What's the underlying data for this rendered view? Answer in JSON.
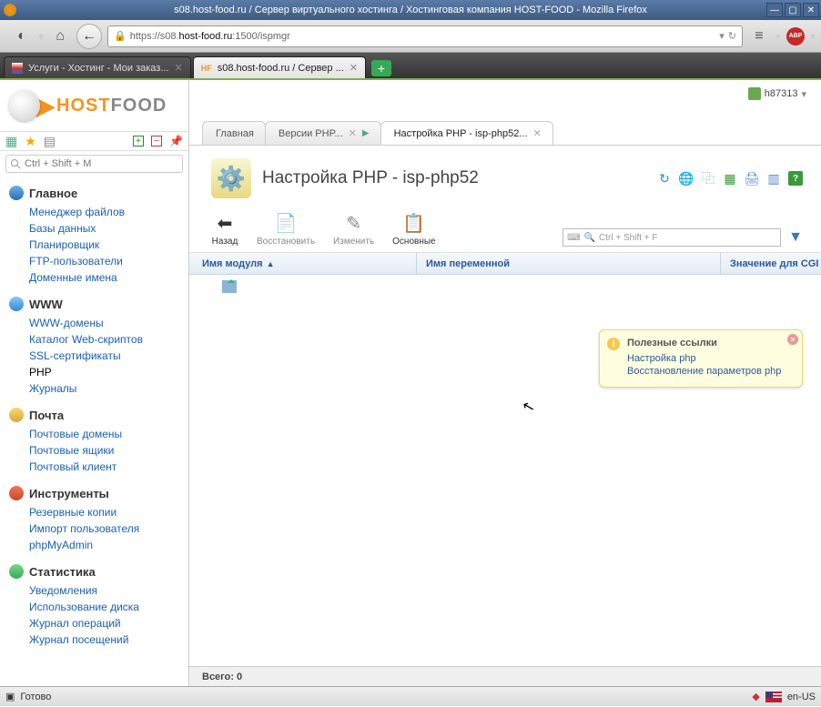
{
  "firefox": {
    "title": "s08.host-food.ru / Сервер виртуального хостинга / Хостинговая компания HOST-FOOD - Mozilla Firefox",
    "url_prefix": "https://s08.",
    "url_host": "host-food.ru",
    "url_suffix": ":1500/ispmgr",
    "tabs": [
      {
        "label": "Услуги - Хостинг - Мои заказ...",
        "active": false
      },
      {
        "label": "s08.host-food.ru / Сервер ...",
        "active": true,
        "prefix": "HF"
      }
    ],
    "status": "Готово",
    "lang": "en-US"
  },
  "logo": {
    "t1": "HOST",
    "t2": "FOOD"
  },
  "left_search_placeholder": "Ctrl + Shift + M",
  "user": "h87313",
  "nav": [
    {
      "title": "Главное",
      "color": "linear-gradient(#6ab0e8,#2a70b8)",
      "items": [
        "Менеджер файлов",
        "Базы данных",
        "Планировщик",
        "FTP-пользователи",
        "Доменные имена"
      ]
    },
    {
      "title": "WWW",
      "color": "linear-gradient(#88c8f8,#3888d0)",
      "items": [
        "WWW-домены",
        "Каталог Web-скриптов",
        "SSL-сертификаты",
        "PHP",
        "Журналы"
      ],
      "selected": 3
    },
    {
      "title": "Почта",
      "color": "linear-gradient(#f8d868,#d8a838)",
      "items": [
        "Почтовые домены",
        "Почтовые ящики",
        "Почтовый клиент"
      ]
    },
    {
      "title": "Инструменты",
      "color": "linear-gradient(#e87858,#c84828)",
      "items": [
        "Резервные копии",
        "Импорт пользователя",
        "phpMyAdmin"
      ]
    },
    {
      "title": "Статистика",
      "color": "linear-gradient(#78d888,#38a858)",
      "items": [
        "Уведомления",
        "Использование диска",
        "Журнал операций",
        "Журнал посещений"
      ]
    }
  ],
  "crumbs": [
    {
      "label": "Главная"
    },
    {
      "label": "Версии PHP...",
      "closable": true,
      "arrow": true
    },
    {
      "label": "Настройка PHP - isp-php52...",
      "closable": true,
      "active": true
    }
  ],
  "page_title": "Настройка PHP - isp-php52",
  "toolbar": [
    {
      "label": "Назад",
      "enabled": true,
      "icon": "⬅"
    },
    {
      "label": "Восстановить",
      "enabled": false,
      "icon": "📄"
    },
    {
      "label": "Изменить",
      "enabled": false,
      "icon": "✎"
    },
    {
      "label": "Основные",
      "enabled": true,
      "icon": "📋"
    }
  ],
  "search_placeholder": "Ctrl + Shift + F",
  "table_headers": [
    "Имя модуля",
    "Имя переменной",
    "Значение для CGI"
  ],
  "hint": {
    "title": "Полезные ссылки",
    "links": [
      "Настройка php",
      "Восстановление параметров php"
    ]
  },
  "footer": "Всего: 0"
}
